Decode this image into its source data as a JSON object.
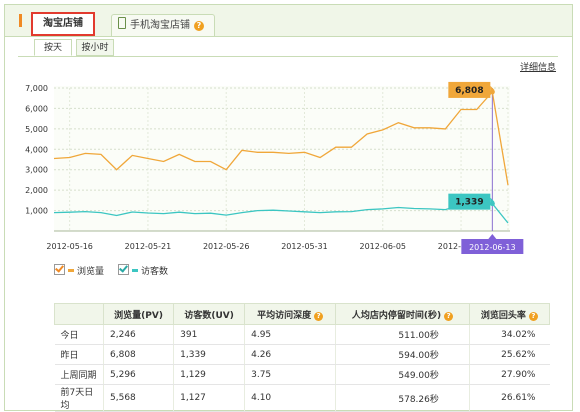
{
  "tabs": {
    "shop": "淘宝店铺",
    "mobile_shop": "手机淘宝店铺",
    "help_glyph": "?"
  },
  "subtabs": {
    "by_day": "按天",
    "by_hour": "按小时"
  },
  "detail_link": "详细信息",
  "chart_data": {
    "type": "line",
    "x": [
      "2012-05-15",
      "2012-05-16",
      "2012-05-17",
      "2012-05-18",
      "2012-05-19",
      "2012-05-20",
      "2012-05-21",
      "2012-05-22",
      "2012-05-23",
      "2012-05-24",
      "2012-05-25",
      "2012-05-26",
      "2012-05-27",
      "2012-05-28",
      "2012-05-29",
      "2012-05-30",
      "2012-05-31",
      "2012-06-01",
      "2012-06-02",
      "2012-06-03",
      "2012-06-04",
      "2012-06-05",
      "2012-06-06",
      "2012-06-07",
      "2012-06-08",
      "2012-06-09",
      "2012-06-10",
      "2012-06-11",
      "2012-06-12",
      "2012-06-13"
    ],
    "x_ticks": [
      "2012-05-16",
      "2012-05-21",
      "2012-05-26",
      "2012-05-31",
      "2012-06-05",
      "2012-06-10",
      "2012-06-13"
    ],
    "highlight_x": "2012-06-13",
    "ylim": [
      0,
      7000
    ],
    "y_ticks": [
      1000,
      2000,
      3000,
      4000,
      5000,
      6000,
      7000
    ],
    "y_tick_labels": [
      "1,000",
      "2,000",
      "3,000",
      "4,000",
      "5,000",
      "6,000",
      "7,000"
    ],
    "grid": true,
    "series": [
      {
        "name": "浏览量",
        "color": "#f0a73a",
        "values": [
          3550,
          3600,
          3800,
          3750,
          3000,
          3700,
          3550,
          3400,
          3750,
          3400,
          3400,
          3000,
          3950,
          3850,
          3850,
          3800,
          3850,
          3600,
          4100,
          4100,
          4750,
          4950,
          5300,
          5050,
          5050,
          5000,
          5950,
          5950,
          6808,
          2246
        ],
        "callout": "6,808"
      },
      {
        "name": "访客数",
        "color": "#3cc6c2",
        "values": [
          900,
          920,
          950,
          900,
          760,
          930,
          880,
          850,
          920,
          850,
          870,
          780,
          900,
          1000,
          1020,
          980,
          940,
          900,
          940,
          950,
          1050,
          1080,
          1150,
          1100,
          1080,
          1050,
          1280,
          1300,
          1339,
          391
        ],
        "callout": "1,339"
      }
    ]
  },
  "stats_table": {
    "headers": [
      "",
      "浏览量(PV)",
      "访客数(UV)",
      "平均访问深度",
      "人均店内停留时间(秒)",
      "浏览回头率"
    ],
    "rows": [
      [
        "今日",
        "2,246",
        "391",
        "4.95",
        "511.00秒",
        "34.02%"
      ],
      [
        "昨日",
        "6,808",
        "1,339",
        "4.26",
        "594.00秒",
        "25.62%"
      ],
      [
        "上周同期",
        "5,296",
        "1,129",
        "3.75",
        "549.00秒",
        "27.90%"
      ],
      [
        "前7天日均",
        "5,568",
        "1,127",
        "4.10",
        "578.26秒",
        "26.61%"
      ]
    ]
  }
}
